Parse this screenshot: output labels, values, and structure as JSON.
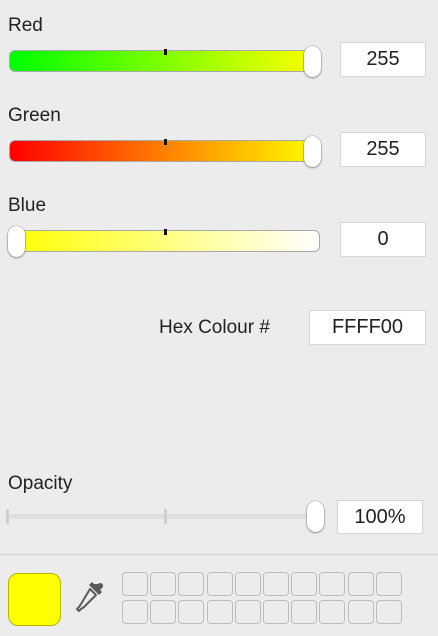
{
  "sliders": [
    {
      "label": "Red",
      "value": "255",
      "level": 1.0,
      "gradient": [
        "#00ff00",
        "#ffff00"
      ]
    },
    {
      "label": "Green",
      "value": "255",
      "level": 1.0,
      "gradient": [
        "#ff0000",
        "#ffff00"
      ]
    },
    {
      "label": "Blue",
      "value": "0",
      "level": 0.0,
      "gradient": [
        "#ffff00",
        "#ffffff"
      ]
    }
  ],
  "hex": {
    "label": "Hex Colour #",
    "value": "FFFF00"
  },
  "opacity": {
    "label": "Opacity",
    "value": "100%",
    "level": 1.0
  },
  "swatch": {
    "color": "#ffff00"
  },
  "picker_icon": "eyedropper-icon",
  "recent_swatches": {
    "rows": 2,
    "columns": 10
  }
}
